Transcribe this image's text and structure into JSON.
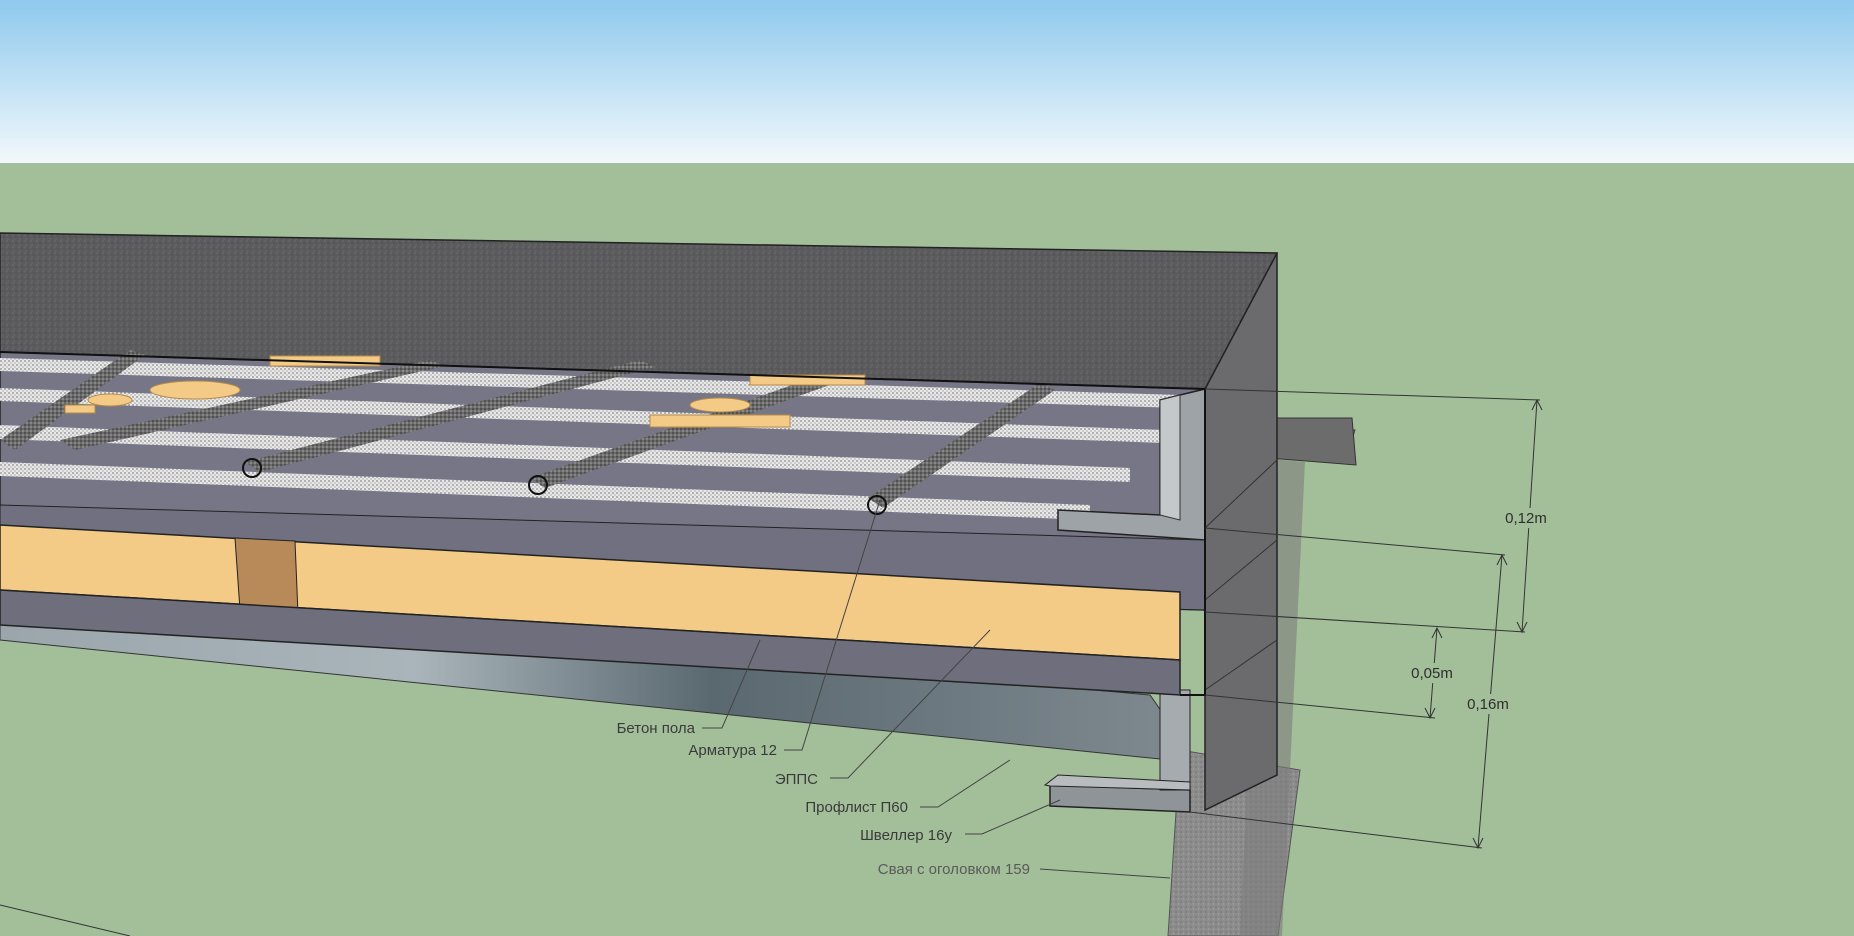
{
  "colors": {
    "sky_top": "#8ec9ee",
    "sky_bottom": "#f2f8fb",
    "ground": "#a3bf9a",
    "concrete": "#5b5b5e",
    "concrete_side": "#6b6b6d",
    "rebar_layer": "#767686",
    "epps": "#f4cb86",
    "steel": "#8a8f94",
    "label_text": "#3a3a3a"
  },
  "callouts": [
    {
      "text": "Бетон пола"
    },
    {
      "text": "Арматура 12"
    },
    {
      "text": "ЭППС"
    },
    {
      "text": "Профлист П60"
    },
    {
      "text": "Швеллер 16у"
    },
    {
      "text": "Свая с оголовком 159"
    }
  ],
  "dimensions": [
    {
      "text": "0,12m"
    },
    {
      "text": "0,05m"
    },
    {
      "text": "0,16m"
    }
  ]
}
